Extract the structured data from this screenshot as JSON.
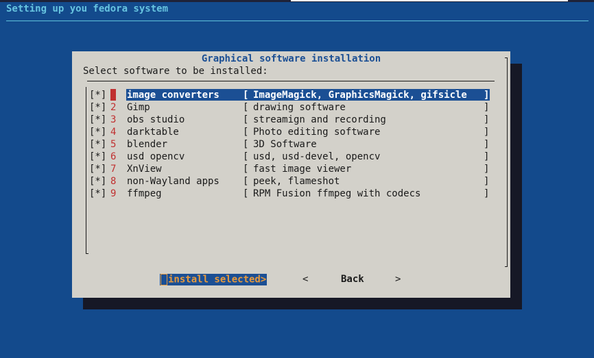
{
  "backtitle": "Setting up you fedora system",
  "dialog": {
    "title": "Graphical software installation",
    "prompt": "Select software to be installed:"
  },
  "checklist": [
    {
      "checked": "[*]",
      "tag": "1",
      "name": "image converters",
      "description": "ImageMagick, GraphicsMagick, gifsicle",
      "selected": true
    },
    {
      "checked": "[*]",
      "tag": "2",
      "name": "Gimp",
      "description": "drawing software"
    },
    {
      "checked": "[*]",
      "tag": "3",
      "name": "obs studio",
      "description": "streamign and recording"
    },
    {
      "checked": "[*]",
      "tag": "4",
      "name": "darktable",
      "description": "Photo editing software"
    },
    {
      "checked": "[*]",
      "tag": "5",
      "name": "blender",
      "description": "3D Software"
    },
    {
      "checked": "[*]",
      "tag": "6",
      "name": "usd opencv",
      "description": "usd, usd-devel, opencv"
    },
    {
      "checked": "[*]",
      "tag": "7",
      "name": "XnView",
      "description": "fast image viewer"
    },
    {
      "checked": "[*]",
      "tag": "8",
      "name": "non-Wayland apps",
      "description": "peek, flameshot"
    },
    {
      "checked": "[*]",
      "tag": "9",
      "name": "ffmpeg",
      "description": "RPM Fusion ffmpeg with codecs"
    }
  ],
  "brackets": {
    "open": "[",
    "close": "]"
  },
  "buttons": {
    "install_text": "install selected>",
    "back_left": "<",
    "back_label": "Back",
    "back_right": ">"
  },
  "colors": {
    "screen_bg": "#134a8c",
    "dialog_bg": "#d3d1ca",
    "accent": "#1b4f94",
    "tag_red": "#c03030",
    "button_text": "#e89a3c"
  }
}
